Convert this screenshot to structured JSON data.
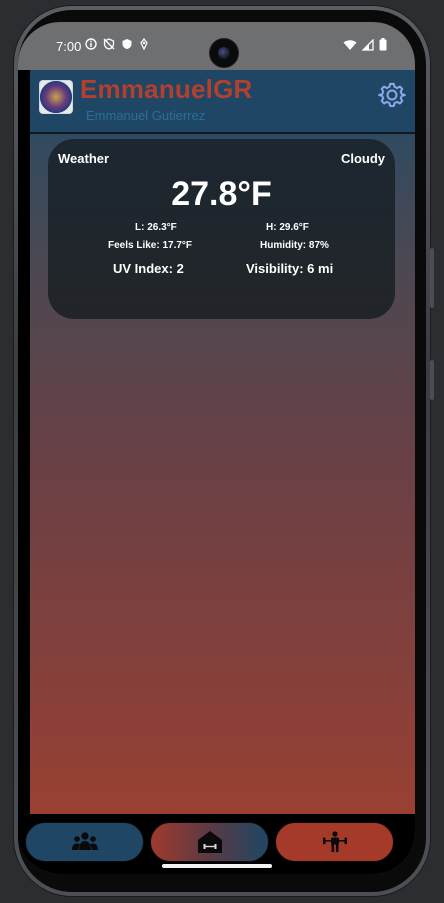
{
  "status_bar": {
    "time": "7:00",
    "left_icons": [
      "info-icon",
      "shield-off-icon",
      "shield-icon",
      "location-icon"
    ],
    "right_icons": [
      "wifi-icon",
      "signal-icon",
      "battery-icon"
    ]
  },
  "app_bar": {
    "title": "EmmanuelGR",
    "subtitle": "Emmanuel Gutierrez",
    "settings_icon": "gear-icon",
    "colors": {
      "title": "#b3402e",
      "subtitle": "#2b6e98",
      "background": "#1f4664"
    }
  },
  "weather": {
    "label": "Weather",
    "condition": "Cloudy",
    "temperature": "27.8°F",
    "low": "L: 26.3°F",
    "high": "H: 29.6°F",
    "feels_like": "Feels Like: 17.7°F",
    "humidity": "Humidity: 87%",
    "uv_index": "UV Index: 2",
    "visibility": "Visibility: 6 mi"
  },
  "bottom_nav": {
    "items": [
      {
        "icon": "group-icon"
      },
      {
        "icon": "home-gym-icon"
      },
      {
        "icon": "weightlifter-icon"
      }
    ]
  }
}
